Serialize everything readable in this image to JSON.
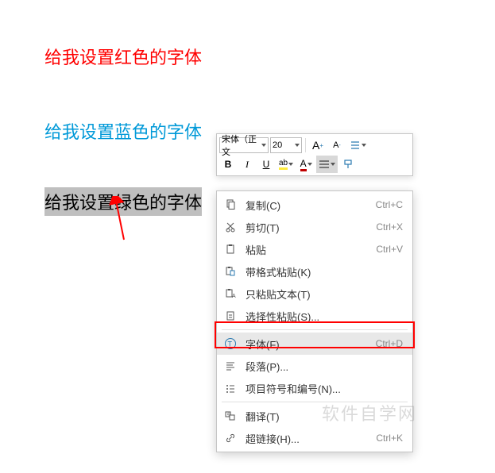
{
  "doc": {
    "line_red": "给我设置红色的字体",
    "line_blue": "给我设置蓝色的字体",
    "line_selected": "给我设置绿色的字体"
  },
  "mini_toolbar": {
    "font_name": "宋体（正文",
    "font_size": "20",
    "bigger_font": "A⁺",
    "smaller_font": "A⁻",
    "bold": "B",
    "italic": "I",
    "underline": "U",
    "highlight": "ab",
    "font_color": "A"
  },
  "menu": {
    "copy": {
      "label": "复制(C)",
      "shortcut": "Ctrl+C"
    },
    "cut": {
      "label": "剪切(T)",
      "shortcut": "Ctrl+X"
    },
    "paste": {
      "label": "粘贴",
      "shortcut": "Ctrl+V"
    },
    "paste_format": {
      "label": "带格式粘贴(K)"
    },
    "paste_text": {
      "label": "只粘贴文本(T)"
    },
    "paste_special": {
      "label": "选择性粘贴(S)..."
    },
    "font": {
      "label": "字体(F)...",
      "shortcut": "Ctrl+D"
    },
    "paragraph": {
      "label": "段落(P)..."
    },
    "bullets": {
      "label": "项目符号和编号(N)..."
    },
    "translate": {
      "label": "翻译(T)"
    },
    "hyperlink": {
      "label": "超链接(H)...",
      "shortcut": "Ctrl+K"
    }
  },
  "watermark": "软件自学网"
}
